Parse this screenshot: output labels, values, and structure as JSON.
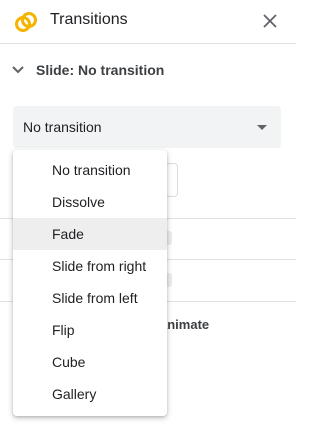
{
  "header": {
    "title": "Transitions",
    "close_icon": "close-icon",
    "logo_icon": "slides-rings-icon",
    "logo_colors": [
      "#f4b400",
      "#f4b400"
    ]
  },
  "section": {
    "title": "Slide: No transition",
    "chevron_icon": "chevron-down-icon"
  },
  "select": {
    "value": "No transition"
  },
  "background": {
    "partial_text": "animate"
  },
  "dropdown": {
    "options": [
      {
        "label": "No transition",
        "highlighted": false
      },
      {
        "label": "Dissolve",
        "highlighted": false
      },
      {
        "label": "Fade",
        "highlighted": true
      },
      {
        "label": "Slide from right",
        "highlighted": false
      },
      {
        "label": "Slide from left",
        "highlighted": false
      },
      {
        "label": "Flip",
        "highlighted": false
      },
      {
        "label": "Cube",
        "highlighted": false
      },
      {
        "label": "Gallery",
        "highlighted": false
      }
    ]
  }
}
